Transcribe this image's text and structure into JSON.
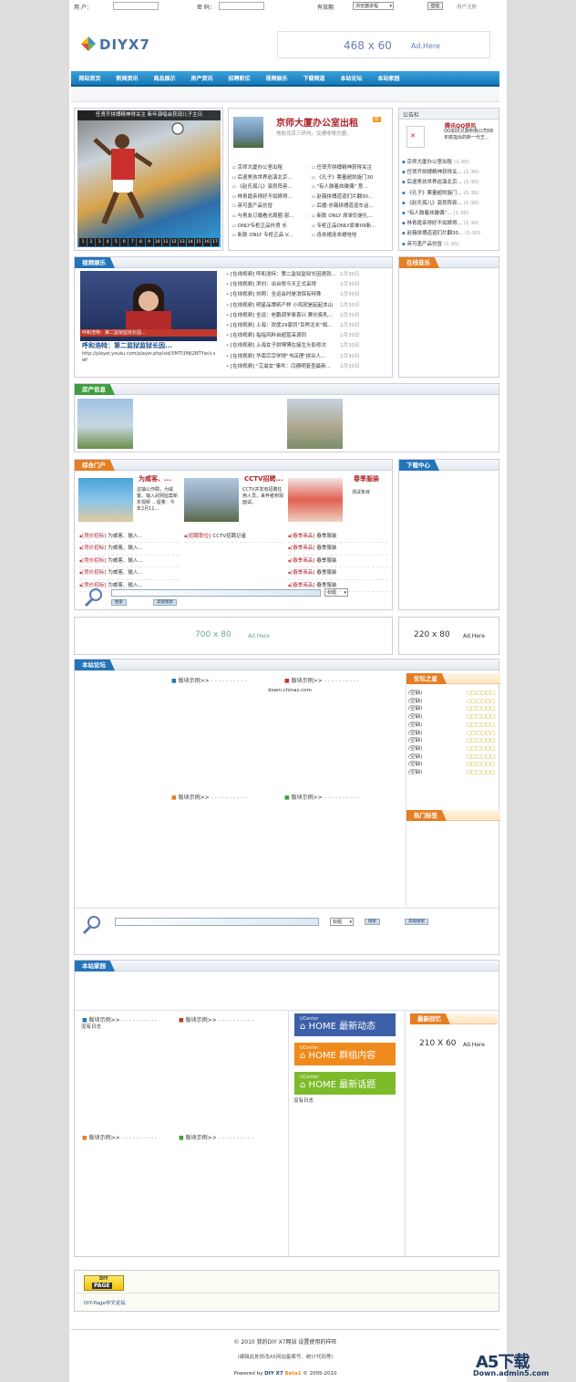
{
  "topbar": {
    "user_label": "用 户：",
    "pass_label": "密 码：",
    "expire_label": "有效期",
    "expire_select": "浏览器进程",
    "login_btn": "登陆",
    "register": "用户注册"
  },
  "logo": {
    "text": "DIYX7"
  },
  "ad_top": {
    "size": "468 x 60",
    "suffix": "Ad.Here"
  },
  "nav": [
    "网站首页",
    "新闻资讯",
    "商品展示",
    "房产资讯",
    "招聘职位",
    "视频娱乐",
    "下载频道",
    "本站论坛",
    "本站家园"
  ],
  "slide": {
    "caption": "任贤齐拼搏精神得关注 新年演唱会获现儿子主日",
    "nums": [
      "1",
      "2",
      "3",
      "4",
      "5",
      "6",
      "7",
      "8",
      "9",
      "10",
      "11",
      "12",
      "13",
      "14",
      "15",
      "16",
      "17"
    ]
  },
  "headline": {
    "title": "京师大厦办公室出租",
    "badge": "新",
    "desc": "地处北京三环内。交通非常方便。"
  },
  "news_left": [
    "京师大厦办公室出租",
    "后退男孩世界巡演北京...",
    "《赵氏孤儿》演员阵容...",
    "林青霞亲得好不如嫁得...",
    "英可盖产品仿冒",
    "与男友订婚看光周圈 恩...",
    "ONLY专柜正品外贸 长",
    "新款 ONLY 专柜正品 V..."
  ],
  "news_right": [
    "任贤齐拼搏精神获得关注",
    "《孔子》票量超凯旋门30",
    "\"有人鼓着炫碟偶\" 意...",
    "赵薇拼搏道道们片翻30...",
    "后援:亦薇拼搏道道车话...",
    "新款 ONLY 原单仍是扎...",
    "专柜正品ONLY原单09新...",
    "连衣裙连衣裙哇哇"
  ],
  "notice": {
    "title": "公告栏",
    "feature_title": "腾讯QQ获风",
    "feature_text": "QQ如风又跑到我公司08年底指出的新一代王...",
    "items": [
      {
        "t": "京师大厦办公室出租",
        "d": "(1-30)"
      },
      {
        "t": "任贤齐拼搏精神获得关...",
        "d": "(1-30)"
      },
      {
        "t": "后退男孩世界巡演北京...",
        "d": "(1-30)"
      },
      {
        "t": "《孔子》票量超凯旋门...",
        "d": "(1-30)"
      },
      {
        "t": "《赵氏孤儿》演员阵容...",
        "d": "(1-30)"
      },
      {
        "t": "\"有人鼓着炫碟偶\"...",
        "d": "(1-30)"
      },
      {
        "t": "林青霞亲得好不如嫁得...",
        "d": "(1-30)"
      },
      {
        "t": "赵薇拼搏道道们片翻30...",
        "d": "(1-30)"
      },
      {
        "t": "英可盖产品仿冒",
        "d": "(1-30)"
      }
    ]
  },
  "video": {
    "tab": "视频娱乐",
    "title": "呼和浩特：第二监狱监狱长因...",
    "url": "http://player.youku.com/player.php/sid/XMTI3MjI2NTYw/v.swf",
    "items": [
      "[在线视频] 呼和浩特：第二监狱监狱长因遇就...",
      "[在线视频] 滨刘：出台修今天正式采得",
      "[在线视频] 刘翔：全运会时是消保有特殊",
      "[在线视频] 明星品牌纸产样 小鸡就是起起本山",
      "[在线视频] 全运：老鹏调学楽喜兴 赛长极乳...",
      "[在线视频] 上海：欢度29家同\"百熊北长\"相...",
      "[在线视频] 指指风料自超蓝采调同",
      "[在线视频] 上海女子拼博博在接生头影修次",
      "[在线视频] 华南宗宗学得\"书店理\"拼众人...",
      "[在线视频] \"艾滋女\"事件：闫德明复查最新..."
    ],
    "date": "1月30日"
  },
  "music": {
    "tab": "在线音乐"
  },
  "house": {
    "tab": "房产信息"
  },
  "portal": {
    "tab": "综合门户",
    "cards": [
      {
        "title": "为威客、...",
        "text": "这抽公作瞬，为威客、输入武网监案新年视频 …留量：今年2月11..."
      },
      {
        "title": "CCTV招聘...",
        "text": "CCTV并发有招聘任用人员，来养者到观面试。"
      },
      {
        "title": "春季服装",
        "text": "测试条目"
      }
    ],
    "list_left": [
      {
        "c": "[竞价招标]",
        "t": "为威客、输入..."
      },
      {
        "c": "[竞价招标]",
        "t": "为威客、输入..."
      },
      {
        "c": "[竞价招标]",
        "t": "为威客、输入..."
      },
      {
        "c": "[竞价招标]",
        "t": "为威客、输入..."
      },
      {
        "c": "[竞价招标]",
        "t": "为威客、输入..."
      }
    ],
    "list_mid": [
      {
        "c": "[招聘职位]",
        "t": "CCTV招聘记者"
      }
    ],
    "list_right": [
      {
        "c": "[春季商品]",
        "t": "春季服装"
      },
      {
        "c": "[春季商品]",
        "t": "春季服装"
      },
      {
        "c": "[春季商品]",
        "t": "春季服装"
      },
      {
        "c": "[春季商品]",
        "t": "春季服装"
      },
      {
        "c": "[春季商品]",
        "t": "春季服装"
      }
    ],
    "select": "标题",
    "search_btn": "搜索",
    "adv_btn": "高级搜索"
  },
  "download": {
    "tab": "下载中心"
  },
  "ad_mid": {
    "size": "700 x 80",
    "suffix": "Ad.Here"
  },
  "ad_small": {
    "size": "220 x 80",
    "suffix": "Ad.Here"
  },
  "forum": {
    "tab": "本站论坛",
    "block_label": "版块示例>>",
    "site": "down.chinaz.com",
    "friends_tab": "论坛之星",
    "friend_item": "(空缺)",
    "friend_dots": "□□□□□□",
    "hot_tab": "热门标签",
    "select": "标题",
    "search_btn": "搜索",
    "adv_btn": "高级搜索"
  },
  "home": {
    "tab": "本站家园",
    "block_label": "版块示例>>",
    "no_log": "没有日志",
    "uc1": "最新动态",
    "uc2": "群组内容",
    "uc3": "最新话题",
    "uc_small": "UCenter",
    "uc_home": "HOME",
    "recent_tab": "最新回忆"
  },
  "ad_home": {
    "size": "210 X 60",
    "suffix": "Ad.Here"
  },
  "links": {
    "badge_top": "DIY",
    "badge_bottom": "PAGE",
    "text": "DIY-Page中文论坛"
  },
  "footer": {
    "line1": "© 2010 我的DIY X7网站  设置使用的样旺",
    "line2": "(编辑此处修改A5网站备案号、统计代码等)",
    "line3_pre": "Powered by ",
    "line3_brand": "DIY X7",
    "line3_beta": "Beta1",
    "line3_post": " © 2005-2010"
  },
  "watermark": {
    "big": "A5下载",
    "small": "Down.admin5.com"
  },
  "colors": {
    "accent": "#2474b8",
    "nav": "#1e88c8",
    "link_red": "#b0232a"
  }
}
